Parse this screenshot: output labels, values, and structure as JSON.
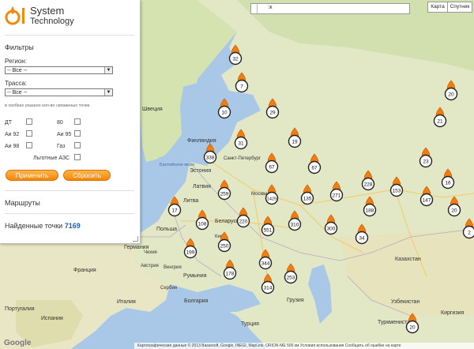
{
  "brand": {
    "title_line1": "System",
    "title_line2": "Technology",
    "logo_letters": "Oil"
  },
  "filters": {
    "heading": "Фильтры",
    "region_label": "Регион:",
    "region_value": "-- Все --",
    "road_label": "Трасса:",
    "road_value": "-- Все --",
    "hint": "в скобках указано кол-во связанных точек",
    "fuels": [
      {
        "label": "ДТ"
      },
      {
        "label": "80"
      },
      {
        "label": "Аи 92"
      },
      {
        "label": "Аи 95"
      },
      {
        "label": "Аи 98"
      },
      {
        "label": "Газ"
      }
    ],
    "preferential": "Льготные АЗС",
    "apply_label": "Применить",
    "reset_label": "Сбросить"
  },
  "routes_label": "Маршруты",
  "found": {
    "label": "Найденные точки",
    "value": "7169"
  },
  "search": {
    "placeholder": "Поиск"
  },
  "map_types": {
    "map": "Карта",
    "satellite": "Спутник"
  },
  "footer": "Картографические данные © 2013 Basarsoft, Google, INEGI, MapLink, ORION-ME   500 км   Условия использования   Сообщить об ошибке на карте",
  "map_labels": [
    {
      "text": "Швеция"
    },
    {
      "text": "Финляндия"
    },
    {
      "text": "Эстония"
    },
    {
      "text": "Балтийское море"
    },
    {
      "text": "Латвия"
    },
    {
      "text": "Литва"
    },
    {
      "text": "Санкт-Петербург"
    },
    {
      "text": "Москва"
    },
    {
      "text": "Беларусь"
    },
    {
      "text": "Польша"
    },
    {
      "text": "Германия"
    },
    {
      "text": "Франция"
    },
    {
      "text": "Италия"
    },
    {
      "text": "Испания"
    },
    {
      "text": "Португалия"
    },
    {
      "text": "Румыния"
    },
    {
      "text": "Болгария"
    },
    {
      "text": "Турция"
    },
    {
      "text": "Грузия"
    },
    {
      "text": "Казахстан"
    },
    {
      "text": "Узбекистан"
    },
    {
      "text": "Туркменистан"
    },
    {
      "text": "Киргизия"
    },
    {
      "text": "Киев"
    },
    {
      "text": "Чехия"
    },
    {
      "text": "Австрия"
    },
    {
      "text": "Венгрия"
    },
    {
      "text": "Сербия"
    }
  ],
  "markers": [
    {
      "value": "32"
    },
    {
      "value": "7"
    },
    {
      "value": "10"
    },
    {
      "value": "29"
    },
    {
      "value": "20"
    },
    {
      "value": "21"
    },
    {
      "value": "338"
    },
    {
      "value": "31"
    },
    {
      "value": "19"
    },
    {
      "value": "23"
    },
    {
      "value": "67"
    },
    {
      "value": "67"
    },
    {
      "value": "228"
    },
    {
      "value": "153"
    },
    {
      "value": "16"
    },
    {
      "value": "259"
    },
    {
      "value": "1429"
    },
    {
      "value": "135"
    },
    {
      "value": "271"
    },
    {
      "value": "147"
    },
    {
      "value": "17"
    },
    {
      "value": "108"
    },
    {
      "value": "220"
    },
    {
      "value": "188"
    },
    {
      "value": "20"
    },
    {
      "value": "551"
    },
    {
      "value": "310"
    },
    {
      "value": "300"
    },
    {
      "value": "34"
    },
    {
      "value": "199"
    },
    {
      "value": "250"
    },
    {
      "value": "344"
    },
    {
      "value": "178"
    },
    {
      "value": "253"
    },
    {
      "value": "314"
    },
    {
      "value": "20"
    },
    {
      "value": "2"
    }
  ]
}
